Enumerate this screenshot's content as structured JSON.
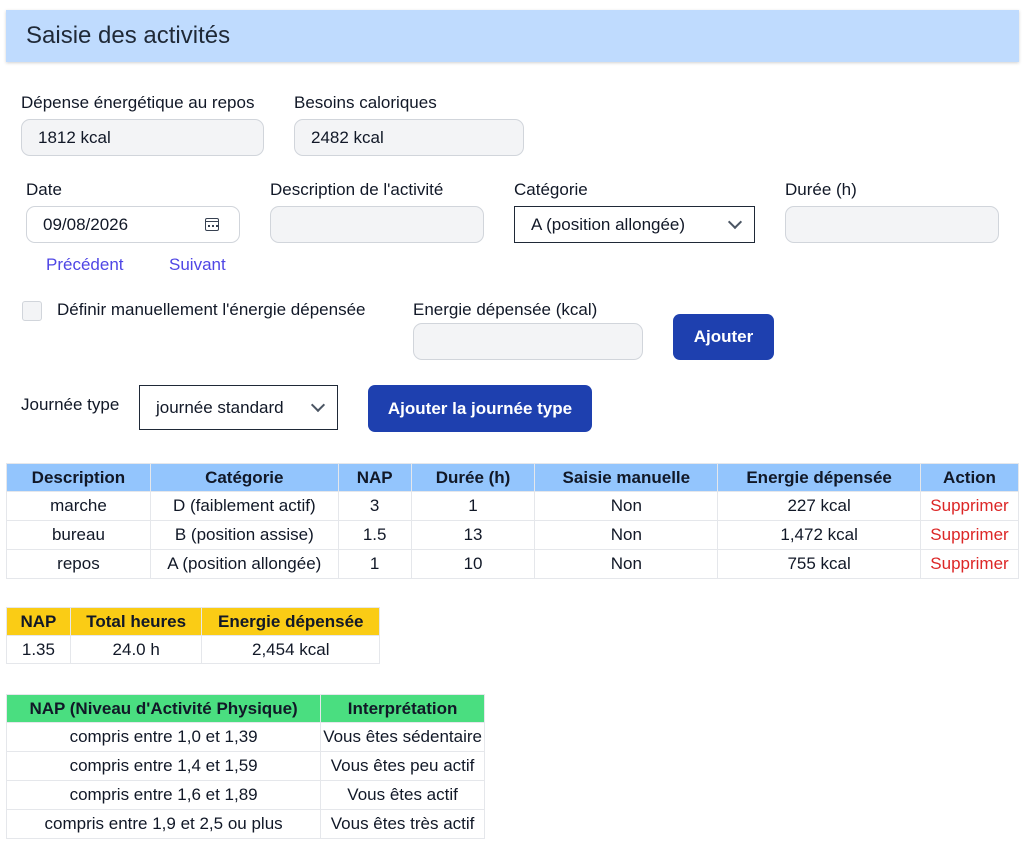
{
  "header": {
    "title": "Saisie des activités"
  },
  "energy": {
    "rest_label": "Dépense énergétique au repos",
    "rest_value": "1812 kcal",
    "needs_label": "Besoins caloriques",
    "needs_value": "2482 kcal"
  },
  "form": {
    "date_label": "Date",
    "date_value": "09/08/2026",
    "prev_label": "Précédent",
    "next_label": "Suivant",
    "description_label": "Description de l'activité",
    "description_value": "",
    "category_label": "Catégorie",
    "category_value": "A (position allongée)",
    "duration_label": "Durée (h)",
    "duration_value": "",
    "manual_label": "Définir manuellement l'énergie dépensée",
    "manual_checked": false,
    "energy_label": "Energie dépensée (kcal)",
    "energy_value": "",
    "add_label": "Ajouter"
  },
  "day_type": {
    "label": "Journée type",
    "value": "journée standard",
    "button_label": "Ajouter la journée type"
  },
  "activities_table": {
    "headers": [
      "Description",
      "Catégorie",
      "NAP",
      "Durée (h)",
      "Saisie manuelle",
      "Energie dépensée",
      "Action"
    ],
    "rows": [
      [
        "marche",
        "D (faiblement actif)",
        "3",
        "1",
        "Non",
        "227 kcal",
        "Supprimer"
      ],
      [
        "bureau",
        "B (position assise)",
        "1.5",
        "13",
        "Non",
        "1,472 kcal",
        "Supprimer"
      ],
      [
        "repos",
        "A (position allongée)",
        "1",
        "10",
        "Non",
        "755 kcal",
        "Supprimer"
      ]
    ]
  },
  "summary_table": {
    "headers": [
      "NAP",
      "Total heures",
      "Energie dépensée"
    ],
    "row": [
      "1.35",
      "24.0 h",
      "2,454 kcal"
    ]
  },
  "nap_table": {
    "headers": [
      "NAP (Niveau d'Activité Physique)",
      "Interprétation"
    ],
    "rows": [
      [
        "compris entre 1,0 et 1,39",
        "Vous êtes sédentaire"
      ],
      [
        "compris entre 1,4 et 1,59",
        "Vous êtes peu actif"
      ],
      [
        "compris entre 1,6 et 1,89",
        "Vous êtes actif"
      ],
      [
        "compris entre 1,9 et 2,5 ou plus",
        "Vous êtes très actif"
      ]
    ]
  },
  "colors": {
    "header_bg": "#bfdbfe",
    "primary_button": "#1e40af",
    "link": "#4f46e5",
    "delete": "#dc2626",
    "activities_header": "#93c5fd",
    "summary_header": "#facc15",
    "nap_header": "#4ade80"
  }
}
